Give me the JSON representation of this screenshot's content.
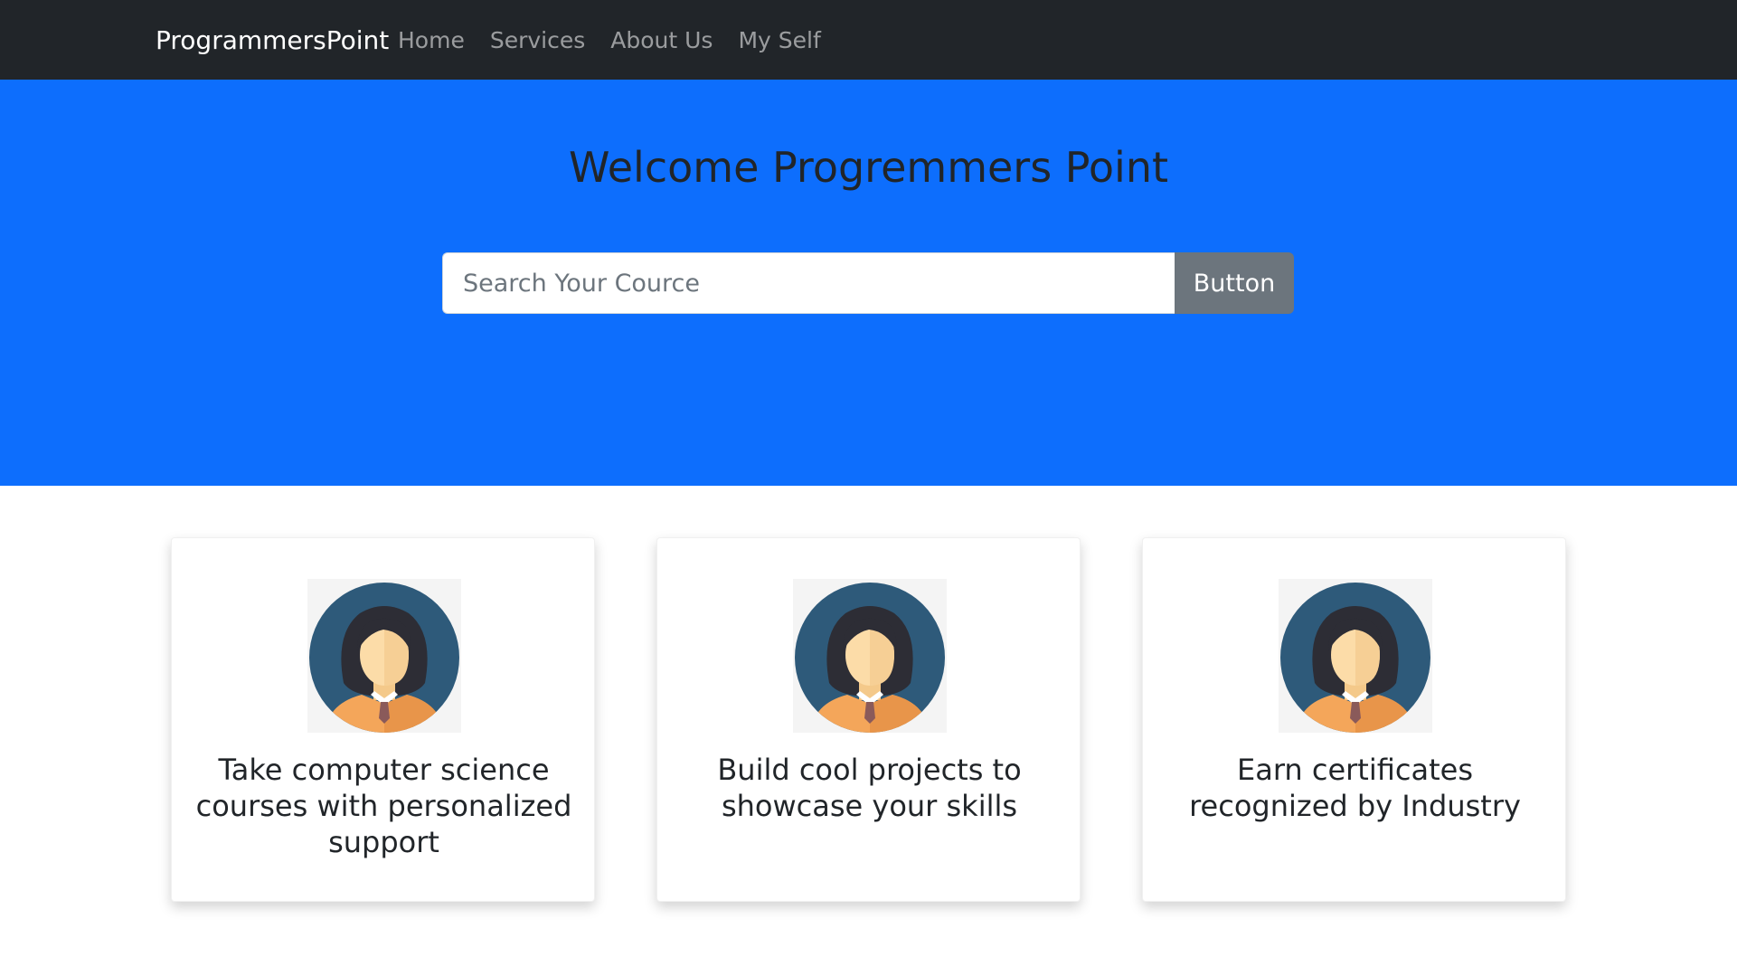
{
  "navbar": {
    "brand": "ProgrammersPoint",
    "links": [
      {
        "label": "Home"
      },
      {
        "label": "Services"
      },
      {
        "label": "About Us"
      },
      {
        "label": "My Self"
      }
    ]
  },
  "hero": {
    "title": "Welcome Progremmers Point",
    "search": {
      "placeholder": "Search Your Cource",
      "value": "",
      "button_label": "Button"
    }
  },
  "cards": [
    {
      "icon": "female-avatar-icon",
      "text": "Take computer science courses with personalized support"
    },
    {
      "icon": "female-avatar-icon",
      "text": "Build cool projects to showcase your skills"
    },
    {
      "icon": "female-avatar-icon",
      "text": "Earn certificates recognized by Industry"
    }
  ],
  "colors": {
    "navbar_bg": "#212529",
    "hero_bg": "#0d6efd",
    "button_bg": "#6c757d",
    "avatar_bg": "#2e5a7a",
    "avatar_hair": "#2d2d35",
    "avatar_skin": "#fcdca8",
    "avatar_shirt": "#f4a65a"
  }
}
